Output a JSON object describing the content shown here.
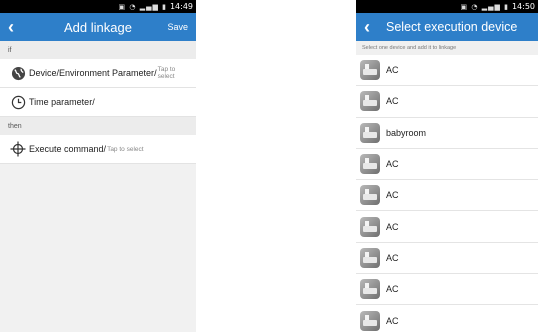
{
  "left": {
    "status": {
      "time": "14:49"
    },
    "header": {
      "title": "Add linkage",
      "save_label": "Save"
    },
    "if_label": "if",
    "then_label": "then",
    "rows": {
      "device_param": {
        "label": "Device/Environment Parameter",
        "sep": "/",
        "hint": "Tap to select",
        "icon": "globe-icon"
      },
      "time_param": {
        "label": "Time parameter",
        "sep": "/",
        "icon": "clock-icon"
      },
      "execute": {
        "label": "Execute command",
        "sep": "/",
        "hint": "Tap to select",
        "icon": "crosshair-icon"
      }
    }
  },
  "right": {
    "status": {
      "time": "14:50"
    },
    "header": {
      "title": "Select execution device"
    },
    "hint": "Select one device and add it to linkage",
    "devices": [
      "AC",
      "AC",
      "babyroom",
      "AC",
      "AC",
      "AC",
      "AC",
      "AC",
      "AC"
    ]
  },
  "colors": {
    "header": "#2e7fc9",
    "status_bar": "#000000"
  }
}
